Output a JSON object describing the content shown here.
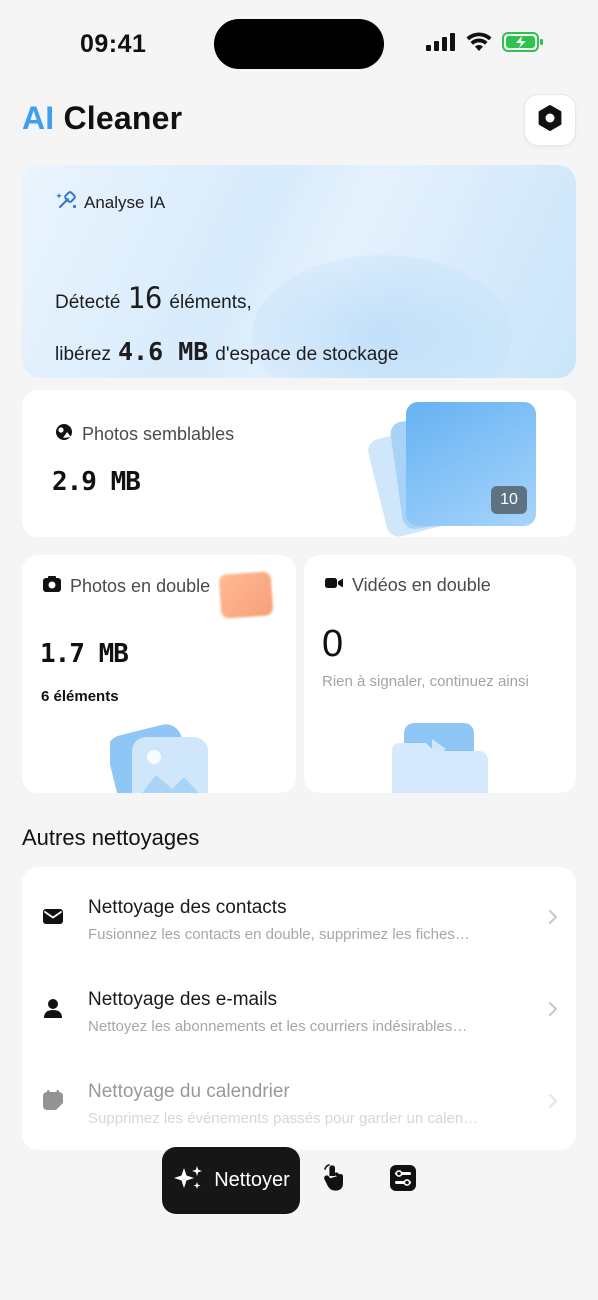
{
  "status_bar": {
    "time": "09:41"
  },
  "header": {
    "title_prefix": "AI",
    "title_rest": " Cleaner"
  },
  "analyse": {
    "label": "Analyse IA",
    "detected_prefix": "Détecté",
    "detected_count": "16",
    "detected_suffix": "éléments,",
    "free_prefix": "libérez",
    "free_size": "4.6 MB",
    "free_suffix": "d'espace de stockage"
  },
  "similar_photos": {
    "label": "Photos semblables",
    "size": "2.9 MB",
    "count": "10"
  },
  "duplicate_photos": {
    "label": "Photos en double",
    "size": "1.7 MB",
    "count_text": "6 éléments"
  },
  "duplicate_videos": {
    "label": "Vidéos en double",
    "count": "0",
    "note": "Rien à signaler, continuez ainsi"
  },
  "others": {
    "title": "Autres nettoyages",
    "items": [
      {
        "title": "Nettoyage des contacts",
        "subtitle": "Fusionnez les contacts en double, supprimez les fiches…",
        "icon": "mail-icon"
      },
      {
        "title": "Nettoyage des e-mails",
        "subtitle": "Nettoyez les abonnements et les courriers indésirables…",
        "icon": "person-icon"
      },
      {
        "title": "Nettoyage du calendrier",
        "subtitle": "Supprimez les événements passés pour garder un calen…",
        "icon": "calendar-icon"
      }
    ]
  },
  "bottom_nav": {
    "clean_label": "Nettoyer"
  },
  "colors": {
    "accent": "#3c9ff0",
    "dark": "#161616",
    "background": "#f5f5f6"
  }
}
